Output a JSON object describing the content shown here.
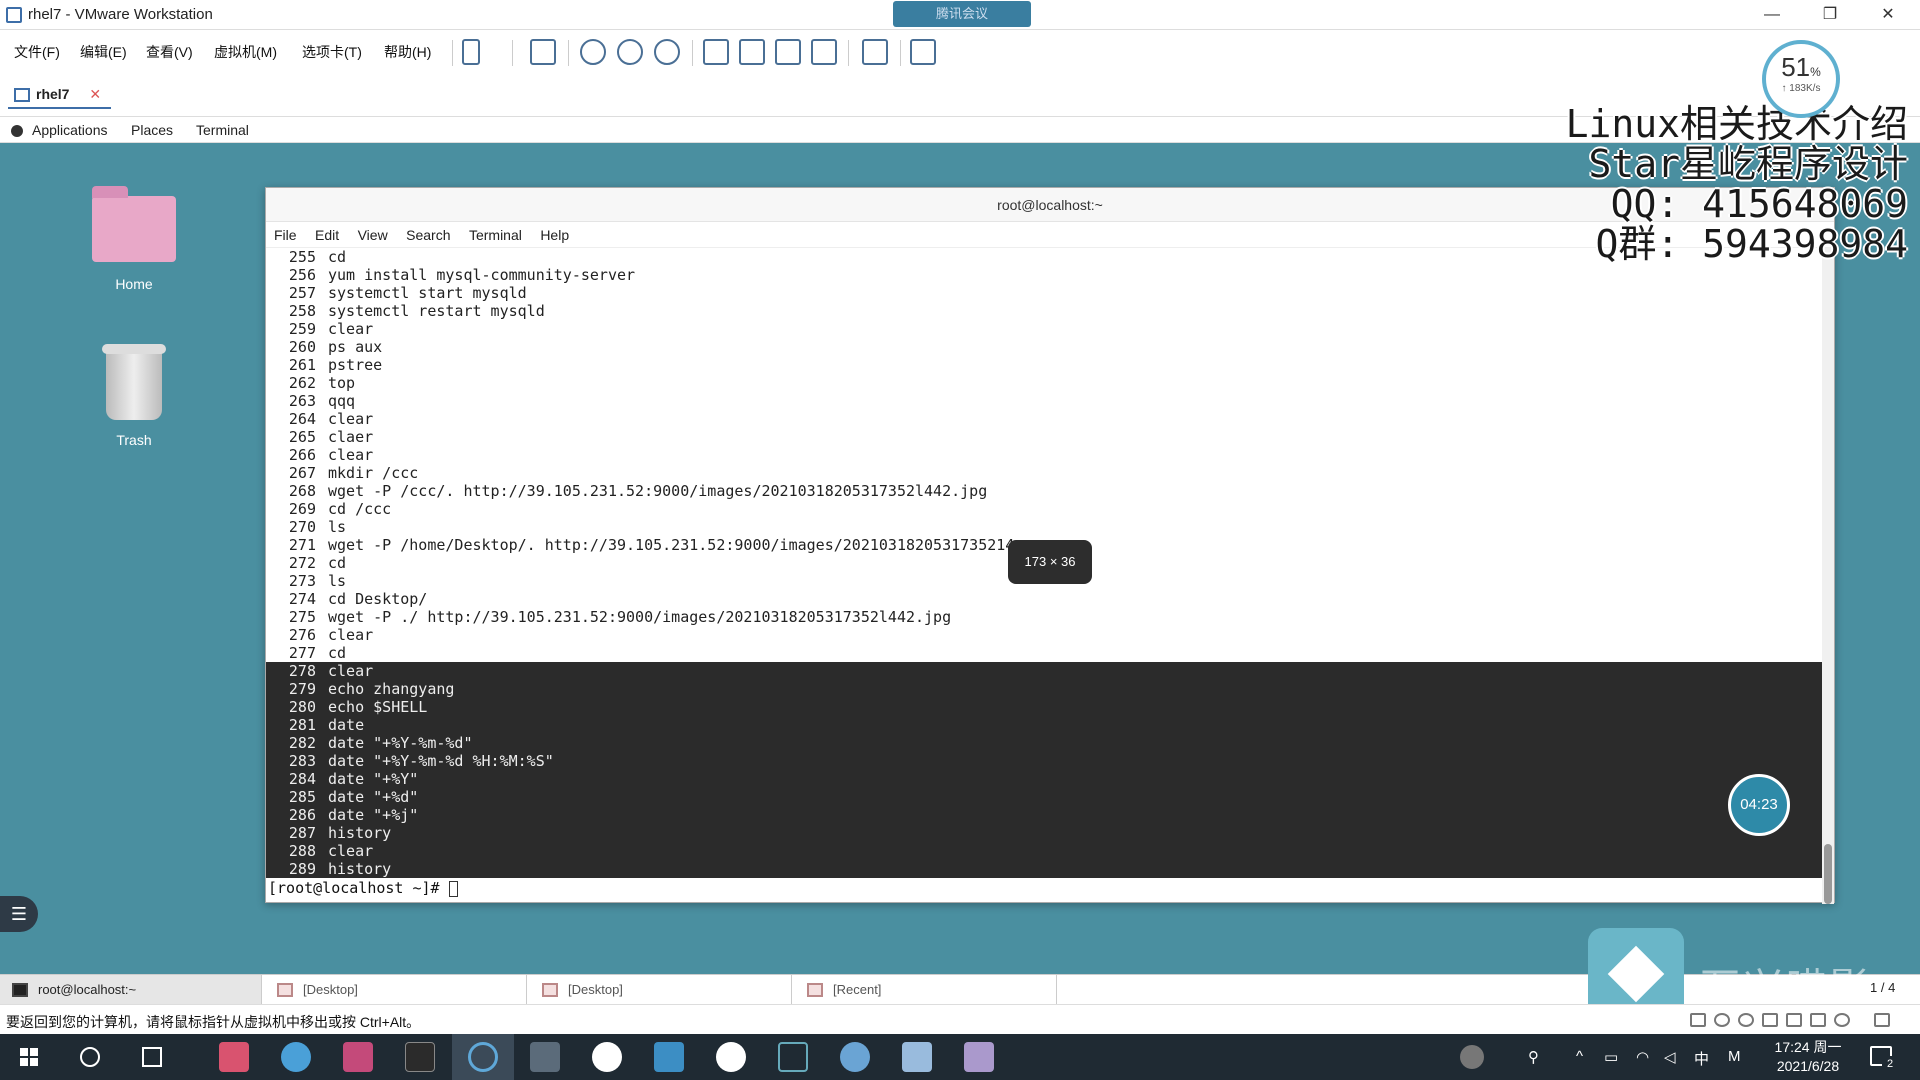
{
  "vmware": {
    "title": "rhel7 - VMware Workstation",
    "meeting": "腾讯会议",
    "window_controls": [
      "—",
      "❐",
      "✕"
    ],
    "menu": [
      "文件(F)",
      "编辑(E)",
      "查看(V)",
      "虚拟机(M)",
      "选项卡(T)",
      "帮助(H)"
    ],
    "tab": {
      "label": "rhel7",
      "close": "✕"
    },
    "status_message": "要返回到您的计算机，请将鼠标指针从虚拟机中移出或按 Ctrl+Alt。"
  },
  "gnome": {
    "top_bar": [
      "Applications",
      "Places",
      "Terminal"
    ],
    "desktop_icons": [
      "Home",
      "Trash"
    ],
    "taskbar": [
      {
        "label": "root@localhost:~",
        "active": true
      },
      {
        "label": "[Desktop]",
        "active": false
      },
      {
        "label": "[Desktop]",
        "active": false
      },
      {
        "label": "[Recent]",
        "active": false
      }
    ]
  },
  "terminal": {
    "title": "root@localhost:~",
    "menu": [
      "File",
      "Edit",
      "View",
      "Search",
      "Terminal",
      "Help"
    ],
    "lines": [
      {
        "n": "255",
        "cmd": "cd",
        "sel": false
      },
      {
        "n": "256",
        "cmd": "yum install mysql-community-server",
        "sel": false
      },
      {
        "n": "257",
        "cmd": "systemctl start mysqld",
        "sel": false
      },
      {
        "n": "258",
        "cmd": "systemctl restart mysqld",
        "sel": false
      },
      {
        "n": "259",
        "cmd": "clear",
        "sel": false
      },
      {
        "n": "260",
        "cmd": "ps aux",
        "sel": false
      },
      {
        "n": "261",
        "cmd": "pstree",
        "sel": false
      },
      {
        "n": "262",
        "cmd": "top",
        "sel": false
      },
      {
        "n": "263",
        "cmd": "qqq",
        "sel": false
      },
      {
        "n": "264",
        "cmd": "clear",
        "sel": false
      },
      {
        "n": "265",
        "cmd": "claer",
        "sel": false
      },
      {
        "n": "266",
        "cmd": "clear",
        "sel": false
      },
      {
        "n": "267",
        "cmd": "mkdir /ccc",
        "sel": false
      },
      {
        "n": "268",
        "cmd": "wget -P /ccc/. http://39.105.231.52:9000/images/20210318205317352l442.jpg",
        "sel": false
      },
      {
        "n": "269",
        "cmd": "cd /ccc",
        "sel": false
      },
      {
        "n": "270",
        "cmd": "ls",
        "sel": false
      },
      {
        "n": "271",
        "cmd": "wget -P /home/Desktop/. http://39.105.231.52:9000/images/2021031820531735214",
        "sel": false
      },
      {
        "n": "272",
        "cmd": "cd",
        "sel": false
      },
      {
        "n": "273",
        "cmd": "ls",
        "sel": false
      },
      {
        "n": "274",
        "cmd": "cd Desktop/",
        "sel": false
      },
      {
        "n": "275",
        "cmd": "wget -P ./ http://39.105.231.52:9000/images/20210318205317352l442.jpg",
        "sel": false
      },
      {
        "n": "276",
        "cmd": "clear",
        "sel": false
      },
      {
        "n": "277",
        "cmd": "cd",
        "sel": false
      },
      {
        "n": "278",
        "cmd": "clear",
        "sel": true
      },
      {
        "n": "279",
        "cmd": "echo zhangyang",
        "sel": true
      },
      {
        "n": "280",
        "cmd": "echo $SHELL",
        "sel": true
      },
      {
        "n": "281",
        "cmd": "date",
        "sel": true
      },
      {
        "n": "282",
        "cmd": "date \"+%Y-%m-%d\"",
        "sel": true
      },
      {
        "n": "283",
        "cmd": "date \"+%Y-%m-%d %H:%M:%S\"",
        "sel": true
      },
      {
        "n": "284",
        "cmd": "date \"+%Y\"",
        "sel": true
      },
      {
        "n": "285",
        "cmd": "date \"+%d\"",
        "sel": true
      },
      {
        "n": "286",
        "cmd": "date \"+%j\"",
        "sel": true
      },
      {
        "n": "287",
        "cmd": "history",
        "sel": true
      },
      {
        "n": "288",
        "cmd": "clear",
        "sel": true
      },
      {
        "n": "289",
        "cmd": "history",
        "sel": true
      }
    ],
    "prompt": "[root@localhost ~]# "
  },
  "overlay": {
    "dimension_tooltip": "173 × 36",
    "watermark": [
      "Linux相关技术介绍",
      "Star星屹程序设计",
      "QQ: 415648069",
      "Q群: 594398984"
    ],
    "cpu_percent": "51",
    "cpu_percent_sign": "%",
    "net_rate": "↑ 183K/s",
    "timer": "04:23",
    "brand": "万兴喵影",
    "page": "1 / 4",
    "side_button": "☰"
  },
  "windows": {
    "clock_time": "17:24 周一",
    "clock_date": "2021/6/28",
    "ime": "中",
    "ime2": "M",
    "notification_count": "2"
  }
}
